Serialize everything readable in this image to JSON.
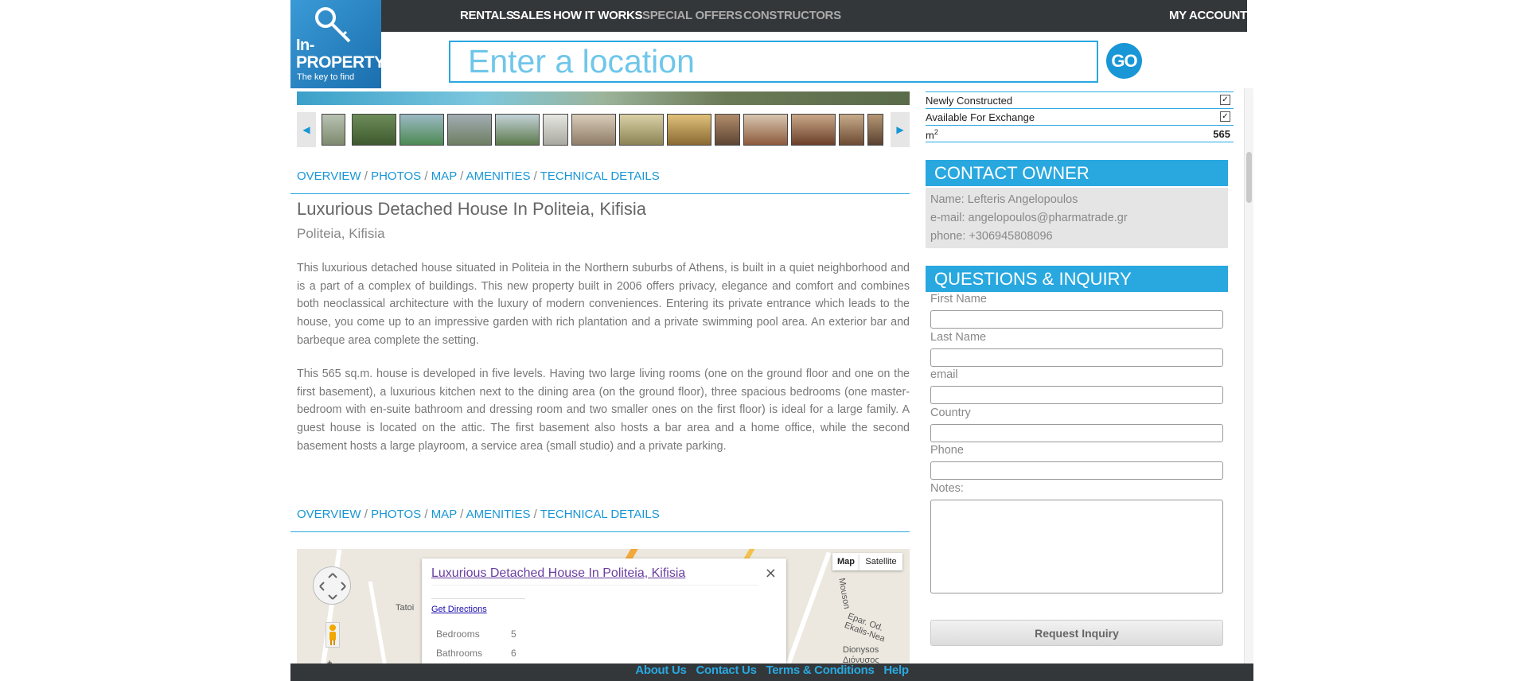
{
  "logo": {
    "line1": "In-",
    "line2": "PROPERTY",
    "tagline": "The key to find"
  },
  "nav": {
    "rentals": "RENTALS",
    "sales": "SALES",
    "how_it_works": "HOW IT WORKS",
    "special_offers": "SPECIAL OFFERS",
    "constructors": "CONSTRUCTORS",
    "my_account": "MY ACCOUNT"
  },
  "search": {
    "placeholder": "Enter a location",
    "go_label": "GO"
  },
  "tabs": [
    "OVERVIEW",
    "PHOTOS",
    "MAP",
    "AMENITIES",
    "TECHNICAL DETAILS"
  ],
  "listing": {
    "title": "Luxurious Detached House In Politeia, Kifisia",
    "location": "Politeia, Kifisia",
    "paragraph1": "This luxurious detached house situated in Politeia in the Northern suburbs of Athens, is built in a quiet neighborhood and is a part of a complex of buildings. This new property built in 2006 offers privacy, elegance and comfort and combines both neoclassical architecture with the luxury of modern conveniences. Entering its private entrance which leads to the house, you come up to an impressive garden with rich plantation and a private swimming pool area. An exterior bar and barbeque area complete the setting.",
    "paragraph2": "This 565 sq.m. house is developed in five levels. Having two large living rooms (one on the ground floor and one on the first basement), a luxurious kitchen next to the dining area (on the ground floor), three spacious bedrooms (one master-bedroom with en-suite bathroom and dressing room and two smaller ones on the first floor) is ideal for a large family. A guest house is located on the attic. The first basement also hosts a bar area and a home office, while the second basement hosts a large playroom, a service area (small studio) and a private parking."
  },
  "map": {
    "popup_title": "Luxurious Detached House In Politeia, Kifisia",
    "close": "×",
    "directions": "Get Directions",
    "bedrooms_label": "Bedrooms",
    "bedrooms_value": "5",
    "bathrooms_label": "Bathrooms",
    "bathrooms_value": "6",
    "map_button": "Map",
    "satellite_button": "Satellite",
    "labels": {
      "tatoi": "Tatoi",
      "dionysos": "Dionysos",
      "dionysos_gr": "Διόνυσος",
      "mouson": "Mouson",
      "ekalis": "Epar. Od. Ekalis-Nea",
      "plus": "+"
    }
  },
  "properties": {
    "newly_constructed": "Newly Constructed",
    "exchange": "Available For Exchange",
    "area_label": "m",
    "area_sup": "2",
    "area_value": "565",
    "check": "✓"
  },
  "contact": {
    "heading": "CONTACT OWNER",
    "name": "Name: Lefteris Angelopoulos",
    "email": "e-mail: angelopoulos@pharmatrade.gr",
    "phone": "phone: +306945808096"
  },
  "inquiry": {
    "heading": "QUESTIONS & INQUIRY",
    "first_name": "First Name",
    "last_name": "Last Name",
    "email": "email",
    "country": "Country",
    "phone": "Phone",
    "notes": "Notes:",
    "submit": "Request Inquiry"
  },
  "footer": {
    "about": "About Us",
    "contact": "Contact Us",
    "terms": "Terms & Conditions",
    "help": "Help"
  },
  "colors": {
    "accent": "#29a8e0",
    "topbar": "#34373a",
    "go_button": "#1896d6"
  },
  "icons": {
    "logo": "key-icon",
    "prev": "chevron-left-icon",
    "next": "chevron-right-icon",
    "pan": "pan-control-icon",
    "pegman": "pegman-icon"
  }
}
